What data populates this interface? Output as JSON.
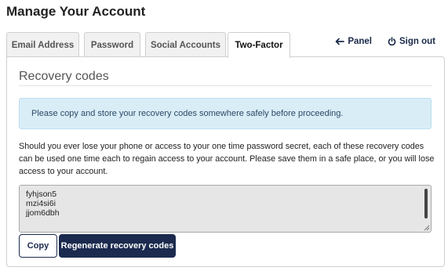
{
  "header": {
    "title": "Manage Your Account"
  },
  "tabs": [
    {
      "label": "Email Address",
      "active": false
    },
    {
      "label": "Password",
      "active": false
    },
    {
      "label": "Social Accounts",
      "active": false
    },
    {
      "label": "Two-Factor",
      "active": true
    }
  ],
  "top_links": {
    "panel": {
      "label": "Panel",
      "icon": "arrow-left-icon"
    },
    "sign_out": {
      "label": "Sign out",
      "icon": "power-icon"
    }
  },
  "recovery": {
    "title": "Recovery codes",
    "alert": "Please copy and store your recovery codes somewhere safely before proceeding.",
    "description": "Should you ever lose your phone or access to your one time password secret, each of these recovery codes can be used one time each to regain access to your account. Please save them in a safe place, or you will lose access to your account.",
    "codes": [
      "fyhjson5",
      "mzi4si6i",
      "jjom6dbh"
    ],
    "copy_label": "Copy",
    "regenerate_label": "Regenerate recovery codes"
  },
  "colors": {
    "primary": "#1b2a4e",
    "alert_bg": "#d9edf7",
    "codes_bg": "#e6e6e6"
  }
}
